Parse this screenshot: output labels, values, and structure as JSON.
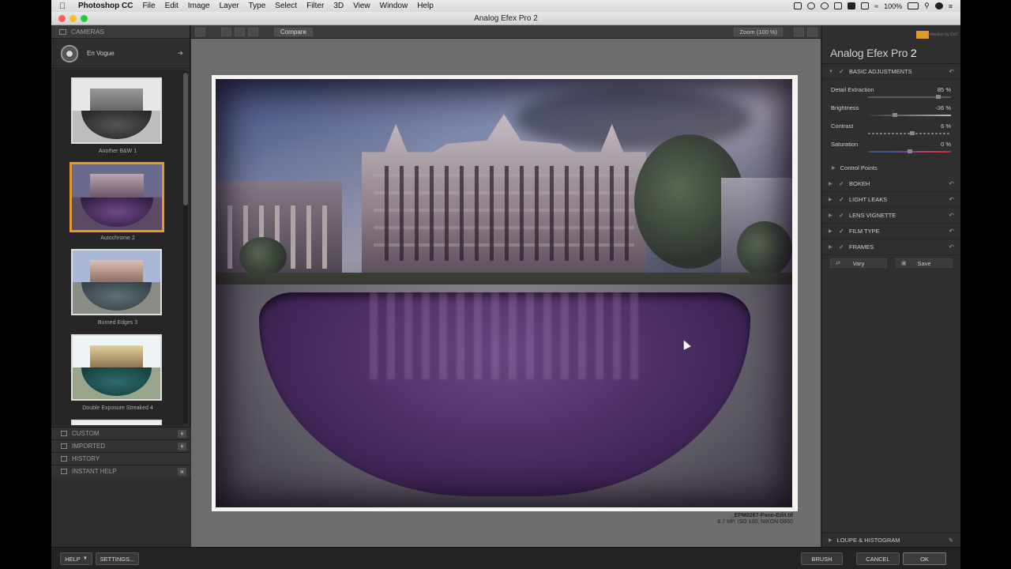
{
  "menubar": {
    "app": "Photoshop CC",
    "menus": [
      "File",
      "Edit",
      "Image",
      "Layer",
      "Type",
      "Select",
      "Filter",
      "3D",
      "View",
      "Window",
      "Help"
    ],
    "battery": "100%"
  },
  "window": {
    "title": "Analog Efex Pro 2"
  },
  "left_panel": {
    "header": "CAMERAS",
    "current_style": "En Vogue",
    "presets": [
      {
        "label": "Another B&W 1"
      },
      {
        "label": "Autochrome 2"
      },
      {
        "label": "Burned Edges 3"
      },
      {
        "label": "Double Exposure Streaked 4"
      }
    ],
    "sections": [
      {
        "label": "CUSTOM",
        "action": "+"
      },
      {
        "label": "IMPORTED",
        "action": "+"
      },
      {
        "label": "HISTORY"
      },
      {
        "label": "INSTANT HELP",
        "action": "×"
      }
    ]
  },
  "toolbar": {
    "compare": "Compare",
    "zoom": "Zoom (100 %)"
  },
  "image_info": {
    "filename": "_EPM0267-Pano-Edit.tif",
    "details": "6.7 MP, ISO 100, NIKON D850"
  },
  "right_panel": {
    "brand_sub": "collection by DxO",
    "title_main": "Analog Efex Pro",
    "title_num": "2",
    "basic_adjustments": "BASIC ADJUSTMENTS",
    "sliders": [
      {
        "name": "Detail Extraction",
        "value": "85 %",
        "level": 0.85
      },
      {
        "name": "Brightness",
        "value": "-36 %",
        "level": 0.32
      },
      {
        "name": "Contrast",
        "value": "6 %",
        "level": 0.53
      },
      {
        "name": "Saturation",
        "value": "0 %",
        "level": 0.5
      }
    ],
    "control_points": "Control Points",
    "sections": [
      "BOKEH",
      "LIGHT LEAKS",
      "LENS VIGNETTE",
      "FILM TYPE",
      "FRAMES"
    ],
    "vary": "Vary",
    "save": "Save",
    "loupe": "LOUPE & HISTOGRAM"
  },
  "bottom": {
    "help": "HELP",
    "settings": "SETTINGS...",
    "brush": "BRUSH",
    "cancel": "CANCEL",
    "ok": "OK"
  },
  "colors": {
    "selection_accent": "#e49b27",
    "brand_orange": "#e39a24",
    "panel_bg": "#2e2e2e",
    "canvas_bg": "#6d6d6d"
  }
}
